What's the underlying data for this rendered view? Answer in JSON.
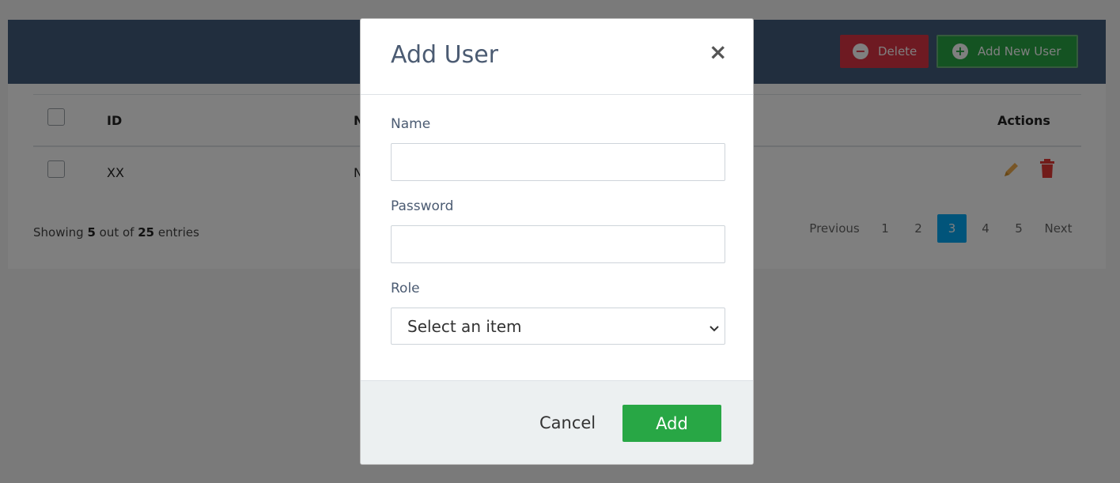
{
  "header": {
    "delete_label": "Delete",
    "add_new_label": "Add New User"
  },
  "table": {
    "columns": [
      "ID",
      "N",
      "Actions"
    ],
    "rows": [
      {
        "id": "XX",
        "name": "N"
      }
    ]
  },
  "footer": {
    "showing_prefix": "Showing",
    "shown_count": "5",
    "out_of_text": "out of",
    "total_count": "25",
    "entries_text": "entries"
  },
  "pagination": {
    "previous_label": "Previous",
    "pages": [
      "1",
      "2",
      "3",
      "4",
      "5"
    ],
    "active_page": "3",
    "next_label": "Next"
  },
  "modal": {
    "title": "Add User",
    "close_glyph": "×",
    "fields": {
      "name_label": "Name",
      "name_value": "",
      "password_label": "Password",
      "password_value": "",
      "role_label": "Role",
      "role_selected": "Select an item"
    },
    "cancel_label": "Cancel",
    "add_label": "Add"
  },
  "colors": {
    "header_bg": "#435d7d",
    "danger": "#dc3545",
    "success": "#28a745",
    "pager_active": "#03a9f4",
    "edit_icon": "#f0ad4e",
    "trash_icon": "#e53935"
  },
  "icons": {
    "delete_button": "minus-circle-icon",
    "add_button": "plus-circle-icon",
    "edit": "pencil-icon",
    "remove": "trash-icon",
    "close": "close-icon",
    "select": "chevron-down-icon"
  }
}
